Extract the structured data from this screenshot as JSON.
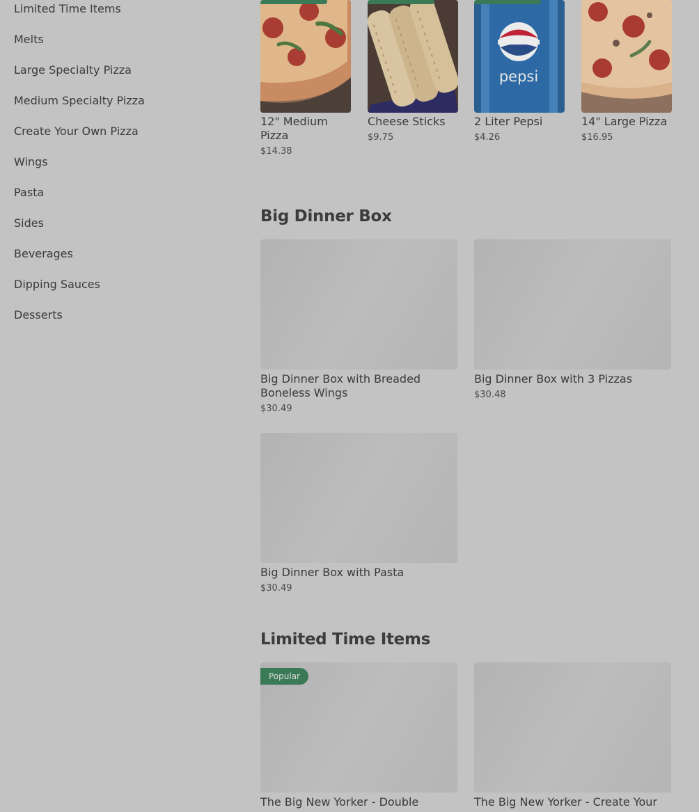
{
  "sidebar": {
    "items": [
      "Limited Time Items",
      "Melts",
      "Large Specialty Pizza",
      "Medium Specialty Pizza",
      "Create Your Own Pizza",
      "Wings",
      "Pasta",
      "Sides",
      "Beverages",
      "Dipping Sauces",
      "Desserts"
    ]
  },
  "popular_items": [
    {
      "title": "12\" Medium Pizza",
      "price": "$14.38"
    },
    {
      "title": "Cheese Sticks",
      "price": "$9.75"
    },
    {
      "title": "2 Liter Pepsi",
      "price": "$4.26"
    },
    {
      "title": "14\" Large Pizza",
      "price": "$16.95"
    }
  ],
  "sections": {
    "big_dinner_box": {
      "title": "Big Dinner Box",
      "items": [
        {
          "title": "Big Dinner Box with Breaded Boneless Wings",
          "price": "$30.49"
        },
        {
          "title": "Big Dinner Box with 3 Pizzas",
          "price": "$30.48"
        },
        {
          "title": "Big Dinner Box with Pasta",
          "price": "$30.49"
        }
      ]
    },
    "limited_time_items": {
      "title": "Limited Time Items",
      "items": [
        {
          "title": "The Big New Yorker - Double",
          "badge": "Popular"
        },
        {
          "title": "The Big New Yorker - Create Your"
        }
      ]
    }
  },
  "product_image_text": {
    "pepsi_logo_text": "pepsi"
  },
  "colors": {
    "overlay_background": "#c3c3c3",
    "badge_green": "#3b7a57",
    "placeholder_gray": "#b7b7b7"
  }
}
